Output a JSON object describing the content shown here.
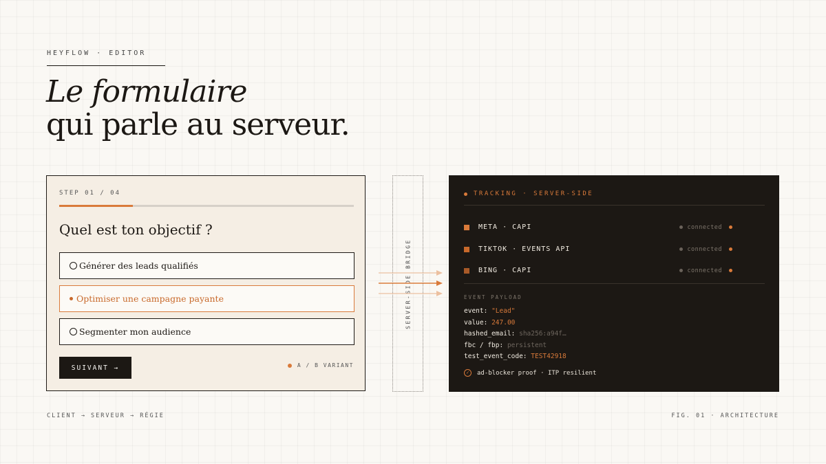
{
  "header": {
    "eyebrow": "HEYFLOW · EDITOR",
    "headline_line1": "Le formulaire",
    "headline_line2": "qui parle au serveur."
  },
  "form": {
    "step": "STEP 01 / 04",
    "progress_fraction": 0.25,
    "question": "Quel est ton objectif ?",
    "options": [
      {
        "label": "Générer des leads qualifiés",
        "selected": false
      },
      {
        "label": "Optimiser une campagne payante",
        "selected": true
      },
      {
        "label": "Segmenter mon audience",
        "selected": false
      }
    ],
    "next_label": "SUIVANT →",
    "variant_label": "A / B VARIANT"
  },
  "bridge": {
    "label": "SERVER-SIDE BRIDGE"
  },
  "tracking": {
    "title": "TRACKING · SERVER-SIDE",
    "destinations": [
      {
        "name": "META · CAPI",
        "status": "connected",
        "color": "#d97a3a"
      },
      {
        "name": "TIKTOK · EVENTS API",
        "status": "connected",
        "color": "#c8692b"
      },
      {
        "name": "BING · CAPI",
        "status": "connected",
        "color": "#a85a28"
      }
    ],
    "payload_label": "EVENT PAYLOAD",
    "payload": [
      {
        "key": "event:",
        "value": "\"Lead\"",
        "tone": "orange"
      },
      {
        "key": "value:",
        "value": "247.00",
        "tone": "orange"
      },
      {
        "key": "hashed_email:",
        "value": "sha256:a94f…",
        "tone": "muted"
      },
      {
        "key": "fbc / fbp:",
        "value": "persistent",
        "tone": "muted"
      },
      {
        "key": "test_event_code:",
        "value": "TEST42918",
        "tone": "orange"
      }
    ],
    "badge": "ad-blocker proof · ITP resilient"
  },
  "footer": {
    "left": "CLIENT → SERVEUR → RÉGIE",
    "right": "FIG. 01 · ARCHITECTURE"
  },
  "colors": {
    "accent": "#d97a3a",
    "ink": "#1c1814",
    "paper": "#faf8f4"
  }
}
